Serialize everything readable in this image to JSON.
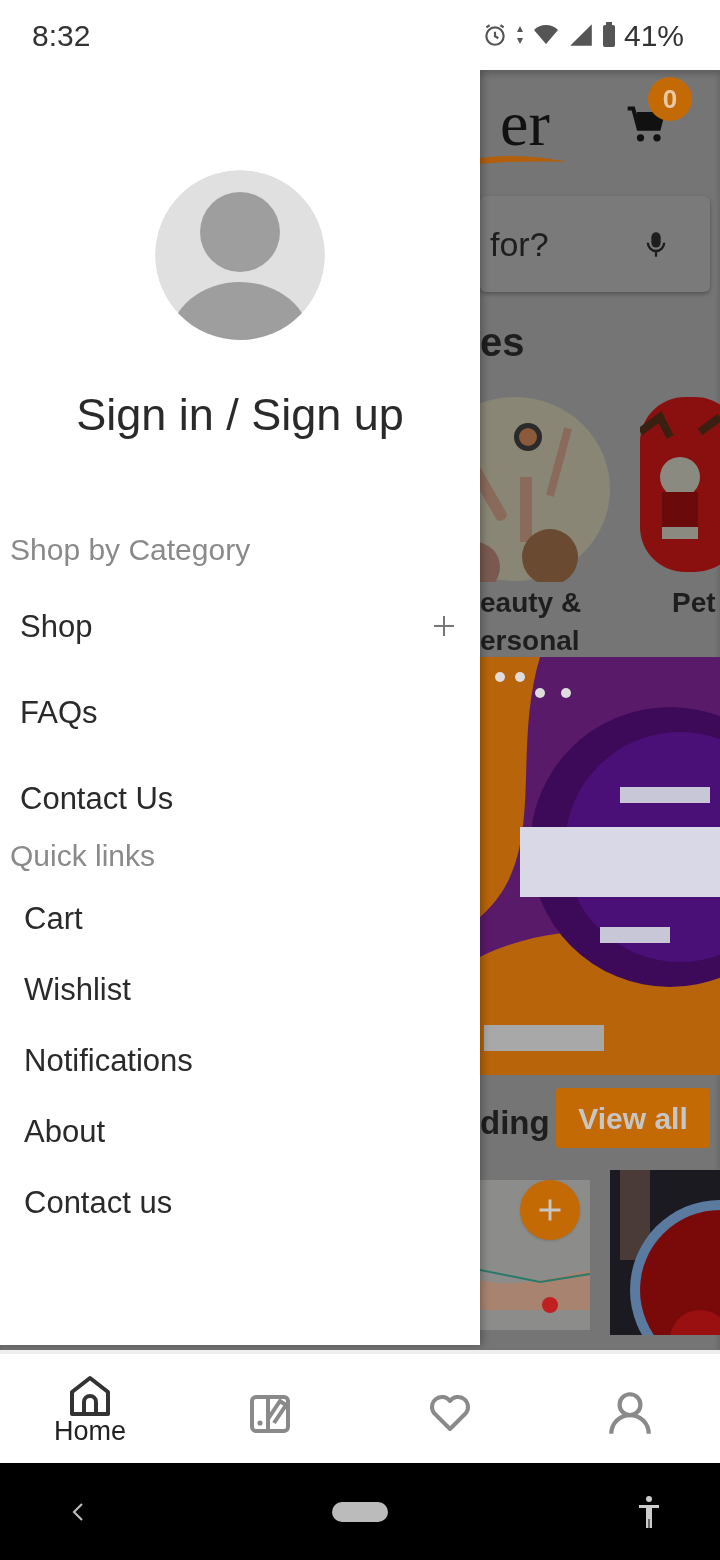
{
  "status_bar": {
    "time": "8:32",
    "battery": "41%"
  },
  "drawer": {
    "sign_in": "Sign in / Sign up",
    "sections": [
      {
        "title": "Shop by Category",
        "kind": "category",
        "items": [
          {
            "label": "Shop",
            "expandable": true
          },
          {
            "label": "FAQs",
            "expandable": false
          },
          {
            "label": "Contact Us",
            "expandable": false
          }
        ]
      },
      {
        "title": "Quick links",
        "kind": "links",
        "items": [
          {
            "label": "Cart",
            "expandable": false
          },
          {
            "label": "Wishlist",
            "expandable": false
          },
          {
            "label": "Notifications",
            "expandable": false
          },
          {
            "label": "About",
            "expandable": false
          },
          {
            "label": "Contact us",
            "expandable": false
          }
        ]
      }
    ]
  },
  "background": {
    "logo": "er",
    "cart_count": "0",
    "search_placeholder": "for?",
    "categories_heading": "es",
    "categories": [
      {
        "lines": [
          "eauty &",
          "ersonal"
        ]
      },
      {
        "lines": [
          "Pet"
        ]
      }
    ],
    "section_heading": "ding",
    "view_all": "View all"
  },
  "bottom_nav": [
    {
      "kind": "home",
      "label": "Home",
      "selected": true
    },
    {
      "kind": "catalog",
      "selected": false
    },
    {
      "kind": "heart",
      "selected": false
    },
    {
      "kind": "person",
      "selected": false
    }
  ]
}
